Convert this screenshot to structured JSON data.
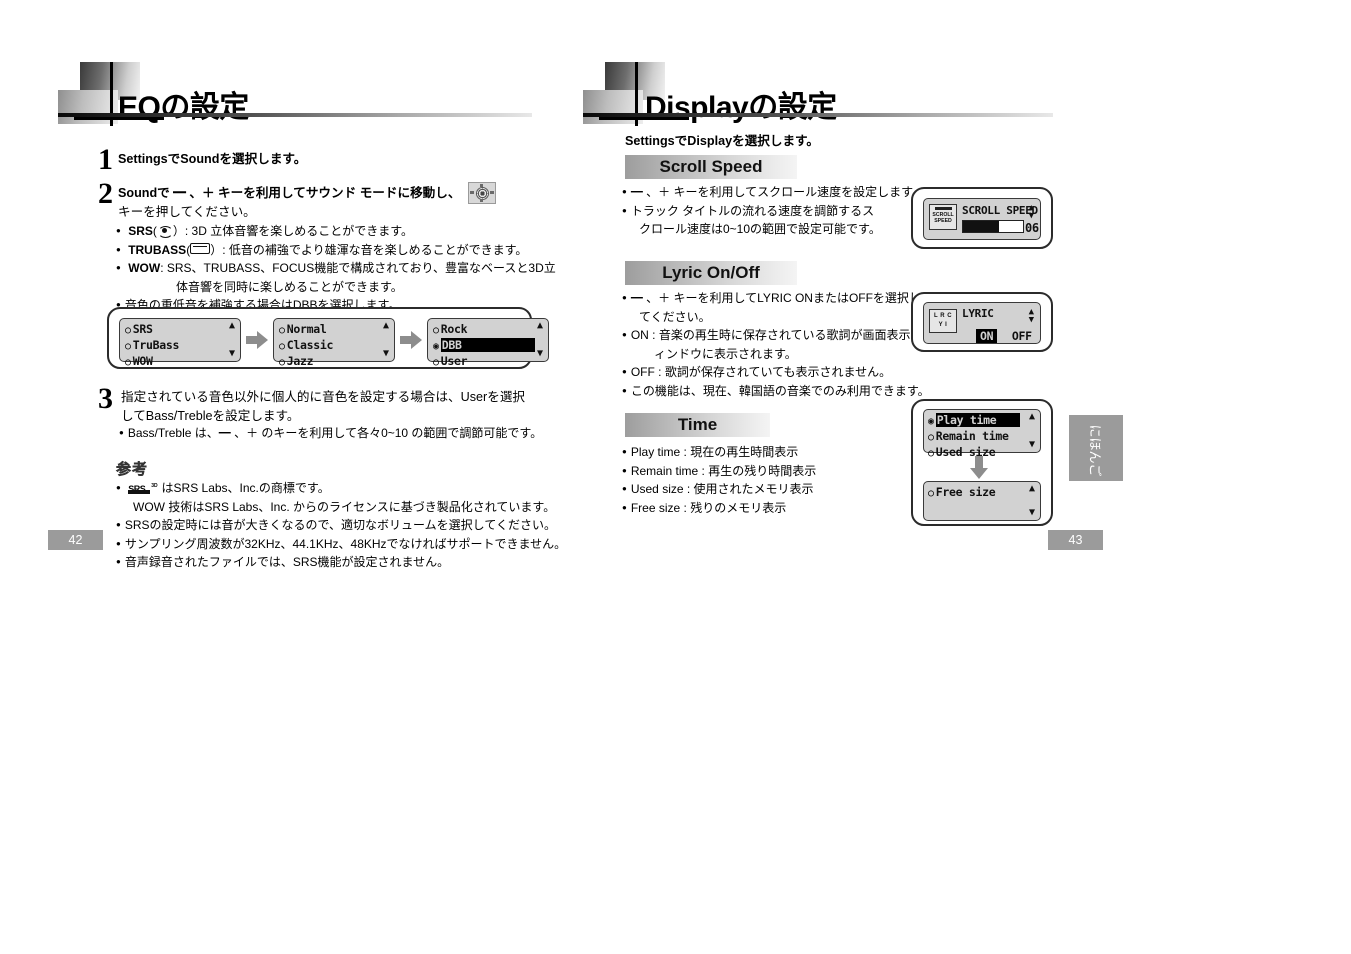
{
  "document": {
    "left_page": {
      "page_number": "42",
      "heading": "EQの設定",
      "steps": [
        {
          "number": "1",
          "lines": [
            "SettingsでSoundを選択します。"
          ]
        },
        {
          "number": "2",
          "lines": [
            "Soundで ━ 、＋ キーを利用してサウンド モードに移動し、",
            "キーを押してください。"
          ],
          "icon": "joystick-navigation-icon"
        },
        {
          "number": "3",
          "lines": [
            "指定されている音色以外に個人的に音色を設定する場合は、Userを選択",
            "してBass/Trebleを設定します。"
          ],
          "sub_bullets": [
            "Bass/Treble は、━ 、＋ のキーを利用して各々0~10 の範囲で調節可能です。"
          ]
        }
      ],
      "step2_bullets": [
        {
          "label": "SRS",
          "icon": "srs-circle-icon",
          "text": "）: 3D 立体音響を楽しめることができます。"
        },
        {
          "label": "TRUBASS",
          "icon": "trubass-bar-icon",
          "text": "）: 低音の補強でより雄渾な音を楽しめることができます。"
        },
        {
          "label": "WOW",
          "icon": "",
          "text": ": SRS、TRUBASS、FOCUS機能で構成されており、豊富なベースと3D立"
        },
        {
          "label": "",
          "icon": "",
          "text": "体音響を同時に楽しめることができます。"
        },
        {
          "label": "",
          "icon": "",
          "text": "音色の重低音を補強する場合はDBBを選択します。"
        }
      ],
      "lcd_flow": [
        {
          "name": "eq-screen-1",
          "rows": [
            {
              "label": "SRS",
              "selected": false
            },
            {
              "label": "TruBass",
              "selected": false
            },
            {
              "label": "WOW",
              "selected": false
            }
          ]
        },
        {
          "name": "eq-screen-2",
          "rows": [
            {
              "label": "Normal",
              "selected": false
            },
            {
              "label": "Classic",
              "selected": false
            },
            {
              "label": "Jazz",
              "selected": false
            }
          ]
        },
        {
          "name": "eq-screen-3",
          "rows": [
            {
              "label": "Rock",
              "selected": false
            },
            {
              "label": "DBB",
              "selected": true
            },
            {
              "label": "User",
              "selected": false
            }
          ]
        }
      ],
      "note": {
        "title": "参考",
        "items": [
          " はSRS Labs、Inc.の商標です。",
          "WOW 技術はSRS Labs、Inc. からのライセンスに基づき製品化されています。",
          "SRSの設定時には音が大きくなるので、適切なボリュームを選択してください。",
          "サンプリング周波数が32KHz、44.1KHz、48KHzでなければサポートできません。",
          "音声録音されたファイルでは、SRS機能が設定されません。"
        ]
      }
    },
    "right_page": {
      "page_number": "43",
      "heading": "Displayの設定",
      "intro": "SettingsでDisplayを選択します。",
      "side_tab_label": "にほんご",
      "sections": [
        {
          "title": "Scroll Speed",
          "bullets": [
            "━ 、＋ キーを利用してスクロール速度を設定します。",
            "トラック タイトルの流れる速度を調節するス",
            "クロール速度は0~10の範囲で設定可能です。"
          ],
          "lcd": {
            "name": "scroll-speed-screen",
            "icon_line1": "SCROLL",
            "icon_line2": "SPEED",
            "title": "SCROLL SPEED",
            "value": "06",
            "progress_percent": 60
          }
        },
        {
          "title": "Lyric On/Off",
          "bullets": [
            "━ 、＋ キーを利用してLYRIC ONまたはOFFを選択し",
            "てください。",
            "ON : 音楽の再生時に保存されている歌詞が画面表示ウ",
            "ィンドウに表示されます。",
            "OFF : 歌詞が保存されていても表示されません。",
            "この機能は、現在、韓国語の音楽でのみ利用できます。"
          ],
          "lcd": {
            "name": "lyric-screen",
            "icon_line1": "L R C",
            "icon_line2": "Y I",
            "title": "LYRIC",
            "option_on": "ON",
            "option_off": "OFF",
            "selected": "ON"
          }
        },
        {
          "title": "Time",
          "bullets": [
            "Play time : 現在の再生時間表示",
            "Remain time : 再生の残り時間表示",
            "Used size : 使用されたメモリ表示",
            "Free size : 残りのメモリ表示"
          ],
          "lcd_flow": [
            {
              "name": "time-screen-1",
              "rows": [
                {
                  "label": "Play time",
                  "selected": true
                },
                {
                  "label": "Remain time",
                  "selected": false
                },
                {
                  "label": "Used size",
                  "selected": false
                }
              ]
            },
            {
              "name": "time-screen-2",
              "rows": [
                {
                  "label": "Free size",
                  "selected": false
                }
              ]
            }
          ]
        }
      ]
    }
  }
}
